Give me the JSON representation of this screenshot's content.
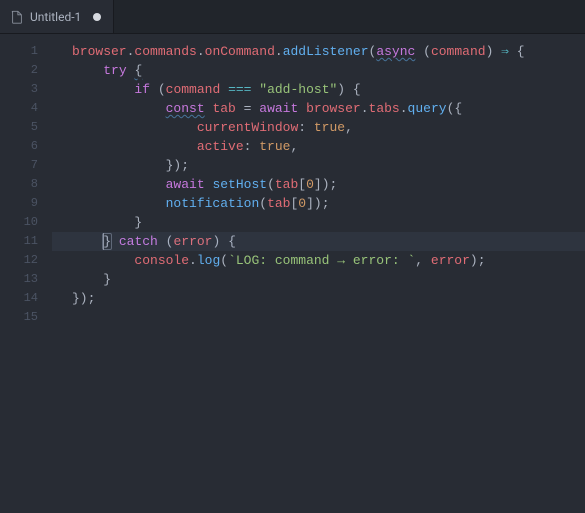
{
  "tab": {
    "title": "Untitled-1",
    "dirty": true,
    "icon": "file-icon"
  },
  "editor": {
    "language": "javascript",
    "cursor": {
      "line": 11,
      "column": 5
    },
    "active_line": 11,
    "line_count": 15,
    "visible_line_numbers": [
      1,
      2,
      3,
      4,
      5,
      6,
      7,
      8,
      9,
      10,
      11,
      12,
      13,
      14,
      15
    ],
    "tokens": [
      [
        {
          "t": "browser",
          "c": "id"
        },
        {
          "t": ".",
          "c": "pn"
        },
        {
          "t": "commands",
          "c": "id"
        },
        {
          "t": ".",
          "c": "pn"
        },
        {
          "t": "onCommand",
          "c": "id"
        },
        {
          "t": ".",
          "c": "pn"
        },
        {
          "t": "addListener",
          "c": "fn"
        },
        {
          "t": "(",
          "c": "pn"
        },
        {
          "t": "async",
          "c": "kw",
          "hint": true
        },
        {
          "t": " (",
          "c": "pn"
        },
        {
          "t": "command",
          "c": "id"
        },
        {
          "t": ") ",
          "c": "pn"
        },
        {
          "t": "⇒",
          "c": "op"
        },
        {
          "t": " {",
          "c": "pn"
        }
      ],
      [
        {
          "t": "    ",
          "c": "pn"
        },
        {
          "t": "try",
          "c": "kw"
        },
        {
          "t": " ",
          "c": "pn"
        },
        {
          "t": "{",
          "c": "pn",
          "hint": true
        }
      ],
      [
        {
          "t": "        ",
          "c": "pn"
        },
        {
          "t": "if",
          "c": "kw"
        },
        {
          "t": " (",
          "c": "pn"
        },
        {
          "t": "command",
          "c": "id"
        },
        {
          "t": " ",
          "c": "pn"
        },
        {
          "t": "===",
          "c": "op"
        },
        {
          "t": " ",
          "c": "pn"
        },
        {
          "t": "\"add-host\"",
          "c": "str"
        },
        {
          "t": ") {",
          "c": "pn"
        }
      ],
      [
        {
          "t": "            ",
          "c": "pn"
        },
        {
          "t": "const",
          "c": "kw",
          "hint": true
        },
        {
          "t": " ",
          "c": "pn"
        },
        {
          "t": "tab",
          "c": "id"
        },
        {
          "t": " = ",
          "c": "pn"
        },
        {
          "t": "await",
          "c": "kw"
        },
        {
          "t": " ",
          "c": "pn"
        },
        {
          "t": "browser",
          "c": "id"
        },
        {
          "t": ".",
          "c": "pn"
        },
        {
          "t": "tabs",
          "c": "id"
        },
        {
          "t": ".",
          "c": "pn"
        },
        {
          "t": "query",
          "c": "fn"
        },
        {
          "t": "({",
          "c": "pn"
        }
      ],
      [
        {
          "t": "                ",
          "c": "pn"
        },
        {
          "t": "currentWindow",
          "c": "id"
        },
        {
          "t": ": ",
          "c": "pn"
        },
        {
          "t": "true",
          "c": "num"
        },
        {
          "t": ",",
          "c": "pn"
        }
      ],
      [
        {
          "t": "                ",
          "c": "pn"
        },
        {
          "t": "active",
          "c": "id"
        },
        {
          "t": ": ",
          "c": "pn"
        },
        {
          "t": "true",
          "c": "num"
        },
        {
          "t": ",",
          "c": "pn"
        }
      ],
      [
        {
          "t": "            });",
          "c": "pn"
        }
      ],
      [
        {
          "t": "            ",
          "c": "pn"
        },
        {
          "t": "await",
          "c": "kw"
        },
        {
          "t": " ",
          "c": "pn"
        },
        {
          "t": "setHost",
          "c": "fn"
        },
        {
          "t": "(",
          "c": "pn"
        },
        {
          "t": "tab",
          "c": "id"
        },
        {
          "t": "[",
          "c": "pn"
        },
        {
          "t": "0",
          "c": "num"
        },
        {
          "t": "]);",
          "c": "pn"
        }
      ],
      [
        {
          "t": "            ",
          "c": "pn"
        },
        {
          "t": "notification",
          "c": "fn"
        },
        {
          "t": "(",
          "c": "pn"
        },
        {
          "t": "tab",
          "c": "id"
        },
        {
          "t": "[",
          "c": "pn"
        },
        {
          "t": "0",
          "c": "num"
        },
        {
          "t": "]);",
          "c": "pn"
        }
      ],
      [
        {
          "t": "        }",
          "c": "pn"
        }
      ],
      [
        {
          "t": "    ",
          "c": "pn"
        },
        {
          "t": "}",
          "c": "pn",
          "match": true
        },
        {
          "t": " ",
          "c": "pn"
        },
        {
          "t": "catch",
          "c": "kw"
        },
        {
          "t": " (",
          "c": "pn"
        },
        {
          "t": "error",
          "c": "id"
        },
        {
          "t": ") {",
          "c": "pn"
        }
      ],
      [
        {
          "t": "        ",
          "c": "pn"
        },
        {
          "t": "console",
          "c": "id"
        },
        {
          "t": ".",
          "c": "pn"
        },
        {
          "t": "log",
          "c": "fn"
        },
        {
          "t": "(",
          "c": "pn"
        },
        {
          "t": "`LOG: command → error: `",
          "c": "str"
        },
        {
          "t": ", ",
          "c": "pn"
        },
        {
          "t": "error",
          "c": "id"
        },
        {
          "t": ");",
          "c": "pn"
        }
      ],
      [
        {
          "t": "    }",
          "c": "pn"
        }
      ],
      [
        {
          "t": "});",
          "c": "pn"
        }
      ],
      []
    ]
  },
  "colors": {
    "background": "#282c34",
    "tabbar": "#21252b",
    "gutter": "#4b5363",
    "text": "#abb2bf",
    "keyword": "#c678dd",
    "identifier": "#e06c75",
    "function": "#61afef",
    "string": "#98c379",
    "number": "#d19a66",
    "operator": "#56b6c2"
  }
}
